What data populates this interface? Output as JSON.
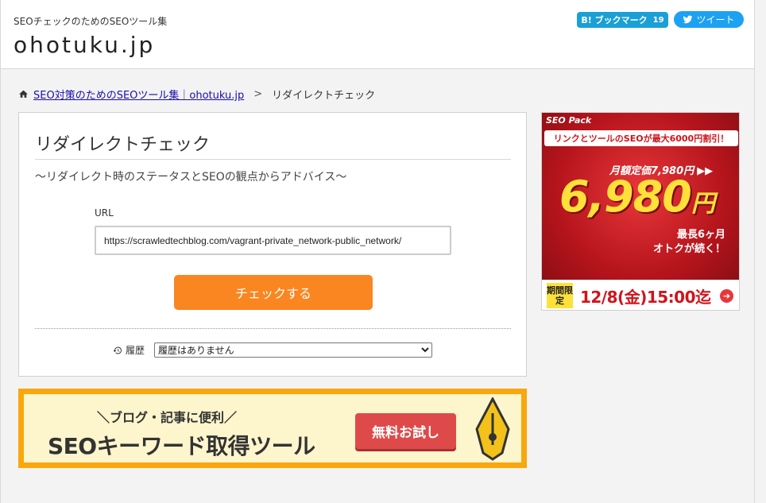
{
  "header": {
    "tagline": "SEOチェックのためのSEOツール集",
    "site_title": "ohotuku.jp",
    "hatena_label": "B! ブックマーク",
    "hatena_count": "19",
    "tweet_label": "ツイート"
  },
  "breadcrumb": {
    "home_link": "SEO対策のためのSEOツール集｜ohotuku.jp",
    "separator": ">",
    "current": "リダイレクトチェック"
  },
  "tool": {
    "title": "リダイレクトチェック",
    "subtitle": "～リダイレクト時のステータスとSEOの観点からアドバイス～",
    "url_label": "URL",
    "url_value": "https://scrawledtechblog.com/vagrant-private_network-public_network/",
    "check_button": "チェックする",
    "history_label": "履歴",
    "history_selected": "履歴はありません"
  },
  "banner": {
    "small_text": "＼ブログ・記事に便利／",
    "large_text": "SEOキーワード取得ツール",
    "button": "無料お試し"
  },
  "ad": {
    "brand": "SEO Pack",
    "promo": "リンクとツールのSEOが最大6000円割引！",
    "regular_price": "月額定価7,980円",
    "regular_arrows": "▶▶",
    "price": "6,980",
    "price_unit": "円",
    "months_line1": "最長6ヶ月",
    "months_line2": "オトクが続く！",
    "limited": "期間限定",
    "deadline": "12/8(金)15:00迄",
    "arrow": "➔"
  },
  "colors": {
    "accent_orange": "#f98621",
    "banner_orange": "#f8a70d",
    "ad_red": "#b5141c",
    "ad_yellow": "#ffe13a",
    "hatena_blue": "#1a9fd6",
    "twitter_blue": "#1da1f2"
  }
}
